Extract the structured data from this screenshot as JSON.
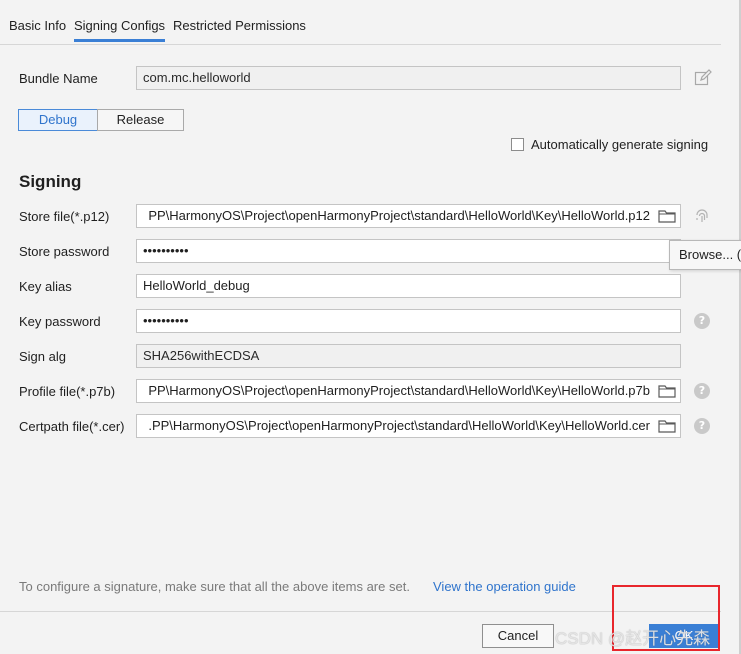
{
  "tabs": [
    {
      "label": "Basic Info",
      "active": false
    },
    {
      "label": "Signing Configs",
      "active": true
    },
    {
      "label": "Restricted Permissions",
      "active": false
    }
  ],
  "bundle": {
    "label": "Bundle Name",
    "value": "com.mc.helloworld"
  },
  "mode": {
    "debug": "Debug",
    "release": "Release",
    "selected": "Debug"
  },
  "auto_sign": {
    "label": "Automatically generate signing",
    "checked": false
  },
  "signing": {
    "title": "Signing",
    "store_file": {
      "label": "Store file(*.p12)",
      "value": "PP\\HarmonyOS\\Project\\openHarmonyProject\\standard\\HelloWorld\\Key\\HelloWorld.p12"
    },
    "store_password": {
      "label": "Store password",
      "value": "••••••••••"
    },
    "key_alias": {
      "label": "Key alias",
      "value": "HelloWorld_debug"
    },
    "key_password": {
      "label": "Key password",
      "value": "••••••••••"
    },
    "sign_alg": {
      "label": "Sign alg",
      "value": "SHA256withECDSA"
    },
    "profile_file": {
      "label": "Profile file(*.p7b)",
      "value": "PP\\HarmonyOS\\Project\\openHarmonyProject\\standard\\HelloWorld\\Key\\HelloWorld.p7b"
    },
    "certpath_file": {
      "label": "Certpath file(*.cer)",
      "value": ".PP\\HarmonyOS\\Project\\openHarmonyProject\\standard\\HelloWorld\\Key\\HelloWorld.cer"
    }
  },
  "tooltip": {
    "text": "Browse... (S"
  },
  "footer": {
    "note": "To configure a signature, make sure that all the above items are set.",
    "guide_link": "View the operation guide",
    "cancel": "Cancel",
    "ok": "OK"
  },
  "watermark": "CSDN @赵开心先森",
  "colors": {
    "accent": "#3a7fd5",
    "highlight_box": "#e8262c"
  }
}
